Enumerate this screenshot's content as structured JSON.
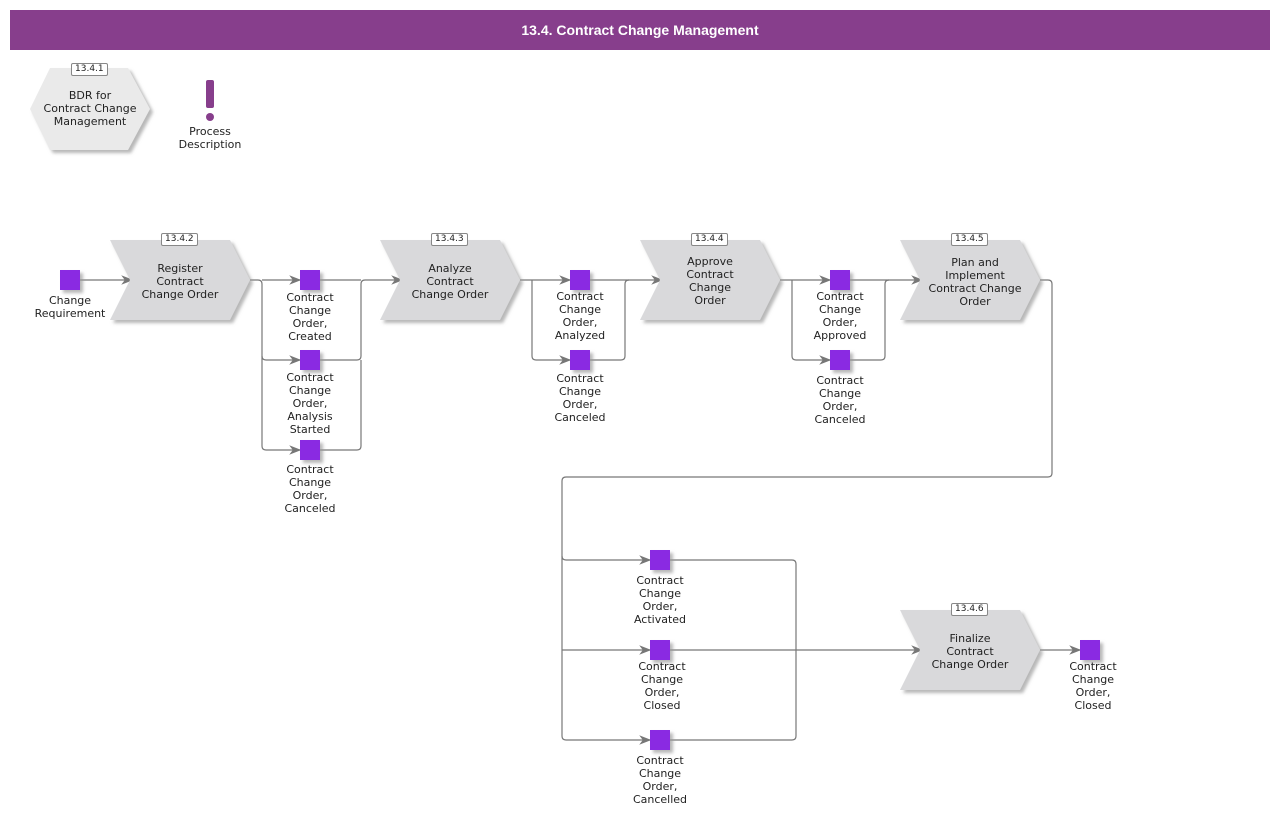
{
  "header": {
    "title": "13.4. Contract Change Management"
  },
  "colors": {
    "header_bg": "#873e8c",
    "event": "#8a2be2",
    "function_fill": "#d9d9db",
    "connector": "#777777"
  },
  "top": {
    "bdr": {
      "number": "13.4.1",
      "label": "BDR for\nContract Change\nManagement"
    },
    "process_description": {
      "icon": "exclamation-icon",
      "label": "Process\nDescription"
    }
  },
  "functions": [
    {
      "number": "13.4.2",
      "label": "Register\nContract\nChange Order"
    },
    {
      "number": "13.4.3",
      "label": "Analyze\nContract\nChange Order"
    },
    {
      "number": "13.4.4",
      "label": "Approve\nContract\nChange\nOrder"
    },
    {
      "number": "13.4.5",
      "label": "Plan and\nImplement\nContract Change\nOrder"
    },
    {
      "number": "13.4.6",
      "label": "Finalize\nContract\nChange Order"
    }
  ],
  "events": [
    {
      "label": "Change\nRequirement"
    },
    {
      "label": "Contract\nChange\nOrder,\nCreated"
    },
    {
      "label": "Contract\nChange\nOrder,\nAnalysis\nStarted"
    },
    {
      "label": "Contract\nChange\nOrder,\nCanceled"
    },
    {
      "label": "Contract\nChange\nOrder,\nAnalyzed"
    },
    {
      "label": "Contract\nChange\nOrder,\nCanceled"
    },
    {
      "label": "Contract\nChange\nOrder,\nApproved"
    },
    {
      "label": "Contract\nChange\nOrder,\nCanceled"
    },
    {
      "label": "Contract\nChange\nOrder,\nActivated"
    },
    {
      "label": "Contract\nChange\nOrder,\nClosed"
    },
    {
      "label": "Contract\nChange\nOrder,\nCancelled"
    },
    {
      "label": "Contract\nChange\nOrder,\nClosed"
    }
  ]
}
